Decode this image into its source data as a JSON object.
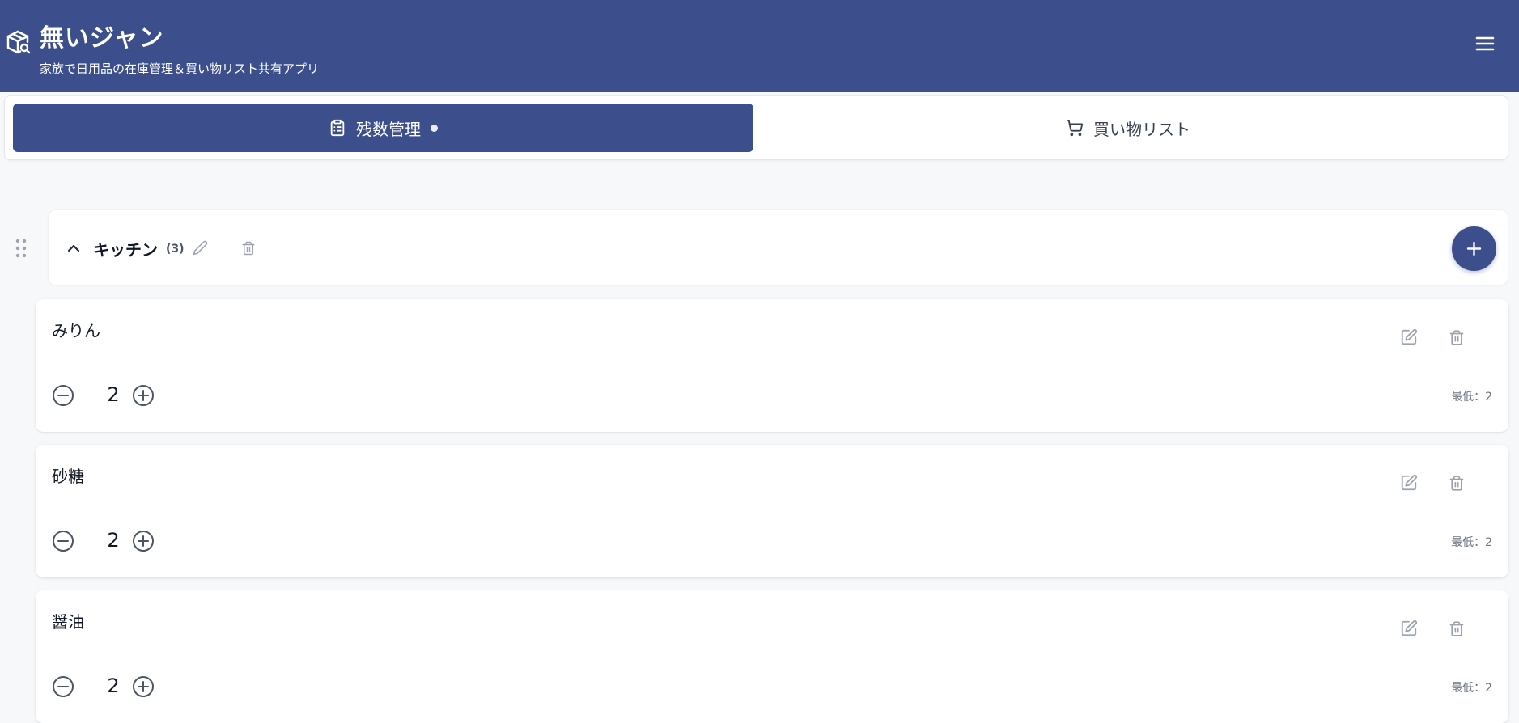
{
  "app": {
    "title": "無いジャン",
    "subtitle": "家族で日用品の在庫管理＆買い物リスト共有アプリ",
    "logo_icon": "package-search-icon",
    "menu_icon": "hamburger-menu-icon",
    "brand_color": "#3d4e8d"
  },
  "tabs": [
    {
      "label": "残数管理",
      "icon": "clipboard-list-icon",
      "active": true,
      "indicator_dot": true
    },
    {
      "label": "買い物リスト",
      "icon": "shopping-cart-icon",
      "active": false
    }
  ],
  "category": {
    "name": "キッチン",
    "count": "(3)",
    "expanded": true,
    "icons": {
      "drag": "drag-handle-icon",
      "toggle": "chevron-up-icon",
      "edit": "pencil-icon",
      "delete": "trash-icon",
      "add": "plus-icon"
    }
  },
  "items": [
    {
      "name": "みりん",
      "quantity": "2",
      "minimum": "最低：2"
    },
    {
      "name": "砂糖",
      "quantity": "2",
      "minimum": "最低：2"
    },
    {
      "name": "醤油",
      "quantity": "2",
      "minimum": "最低：2"
    }
  ]
}
